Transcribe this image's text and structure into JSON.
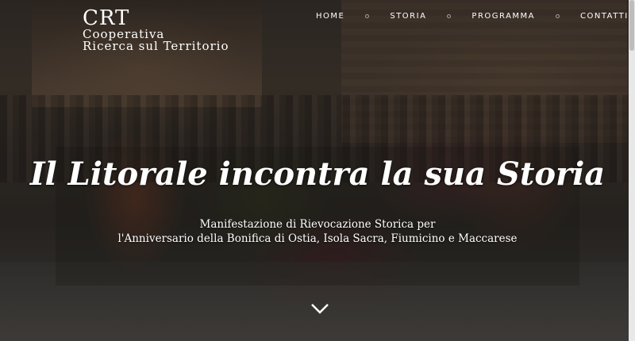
{
  "logo": {
    "title": "CRT",
    "line1": "Cooperativa",
    "line2": "Ricerca sul Territorio"
  },
  "nav": {
    "items": [
      {
        "label": "HOME",
        "active": true
      },
      {
        "label": "STORIA",
        "active": false
      },
      {
        "label": "PROGRAMMA",
        "active": false
      },
      {
        "label": "CONTATTI",
        "active": false
      }
    ]
  },
  "hero": {
    "title": "Il Litorale incontra la sua Storia",
    "subtitle_line1": "Manifestazione di Rievocazione Storica per",
    "subtitle_line2": "l'Anniversario della Bonifica di Ostia, Isola Sacra, Fiumicino e Maccarese",
    "scroll_icon": "chevron-down-icon"
  },
  "colors": {
    "text": "#ffffff",
    "overlay": "#1a1612"
  }
}
